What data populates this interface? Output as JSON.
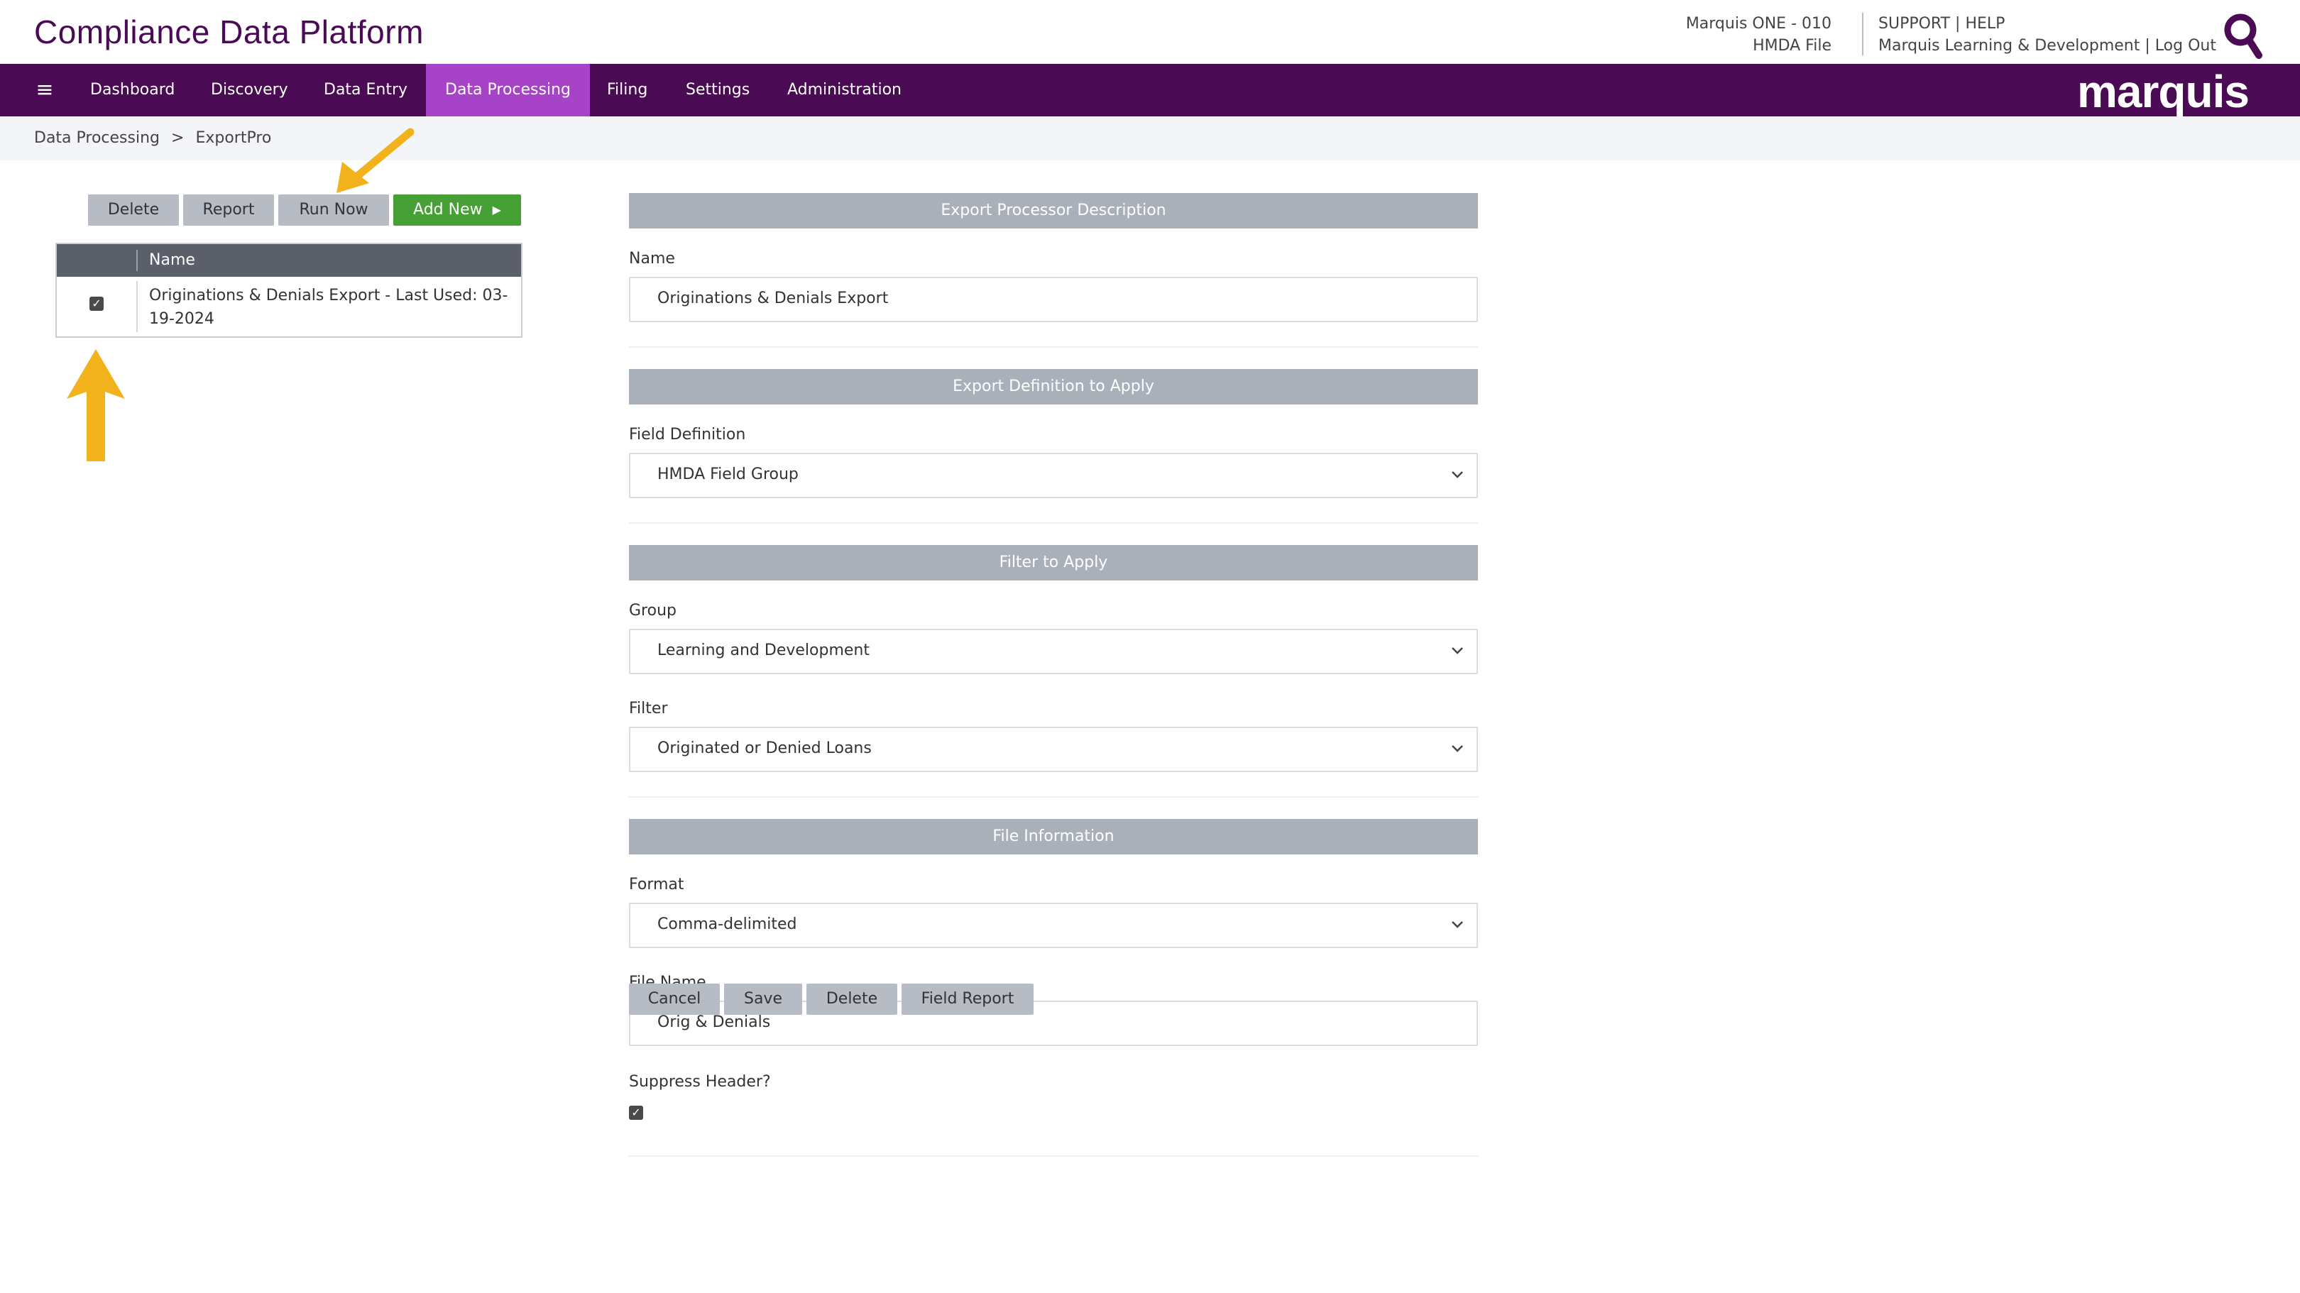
{
  "header": {
    "app_title": "Compliance Data Platform",
    "org_line1": "Marquis ONE - 010",
    "org_line2": "HMDA File",
    "support": "SUPPORT",
    "help": "HELP",
    "user_org": "Marquis Learning & Development",
    "logout": "Log Out",
    "pipe": "|"
  },
  "nav": {
    "menu_icon": "≡",
    "items": [
      "Dashboard",
      "Discovery",
      "Data Entry",
      "Data Processing",
      "Filing",
      "Settings",
      "Administration"
    ],
    "active": "Data Processing",
    "brand": "marquis"
  },
  "breadcrumb": {
    "level1": "Data Processing",
    "separator": ">",
    "level2": "ExportPro"
  },
  "list_toolbar": {
    "delete": "Delete",
    "report": "Report",
    "run_now": "Run Now",
    "add_new": "Add New",
    "add_new_icon": "▶"
  },
  "list": {
    "column_name": "Name",
    "rows": [
      {
        "name": "Originations & Denials Export - Last Used: 03-19-2024",
        "checked": true
      }
    ]
  },
  "form": {
    "section_description": "Export Processor Description",
    "name_label": "Name",
    "name_value": "Originations & Denials Export",
    "section_definition": "Export Definition to Apply",
    "field_definition_label": "Field Definition",
    "field_definition_value": "HMDA Field Group",
    "section_filter": "Filter to Apply",
    "group_label": "Group",
    "group_value": "Learning and Development",
    "filter_label": "Filter",
    "filter_value": "Originated or Denied Loans",
    "section_file": "File Information",
    "format_label": "Format",
    "format_value": "Comma-delimited",
    "file_name_label": "File Name",
    "file_name_value": "Orig & Denials",
    "suppress_header_label": "Suppress Header?",
    "suppress_header_checked": true
  },
  "form_buttons": {
    "cancel": "Cancel",
    "save": "Save",
    "delete": "Delete",
    "field_report": "Field Report"
  },
  "colors": {
    "brand_purple": "#4b0a54",
    "nav_active": "#a743c7",
    "add_green": "#46a036",
    "section_gray": "#aab0ba",
    "callout_orange": "#f2b21c"
  },
  "icons": {
    "search": "search-icon",
    "menu": "hamburger-icon",
    "chevron": "chevron-down-icon",
    "checkbox": "checkbox-checked-icon"
  }
}
